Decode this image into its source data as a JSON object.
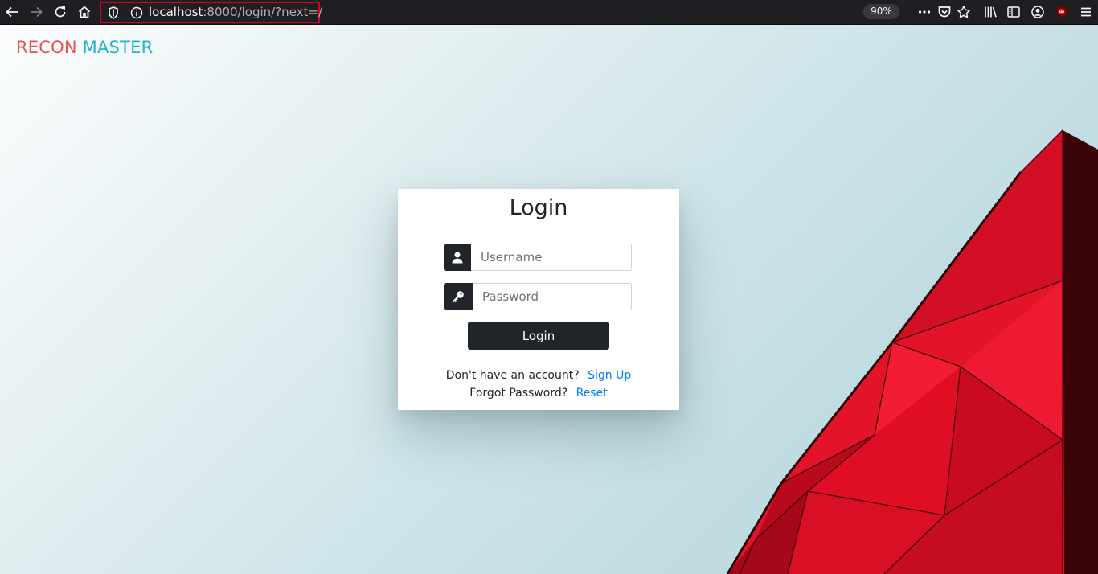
{
  "browser": {
    "url_host": "localhost",
    "url_rest": ":8000/login/?next=/",
    "zoom": "90%",
    "icons": [
      "back-icon",
      "forward-icon",
      "reload-icon",
      "home-icon",
      "tracking-shield-icon",
      "site-info-icon",
      "page-actions-icon",
      "pocket-icon",
      "bookmark-star-icon",
      "library-icon",
      "sidebar-icon",
      "account-icon",
      "ublock-icon",
      "menu-icon"
    ],
    "colors": {
      "toolbar": "#1f1f23",
      "url_highlight": "#d70022"
    }
  },
  "brand": {
    "part1": "RECON",
    "part2": "MASTER",
    "colors": {
      "part1": "#e8524f",
      "part2": "#22b2cc"
    }
  },
  "login": {
    "title": "Login",
    "username_placeholder": "Username",
    "password_placeholder": "Password",
    "submit_label": "Login",
    "signup_prompt": "Don't have an account?",
    "signup_link": "Sign Up",
    "forgot_prompt": "Forgot Password?",
    "reset_link": "Reset",
    "colors": {
      "button": "#212529",
      "link": "#007bff"
    }
  }
}
